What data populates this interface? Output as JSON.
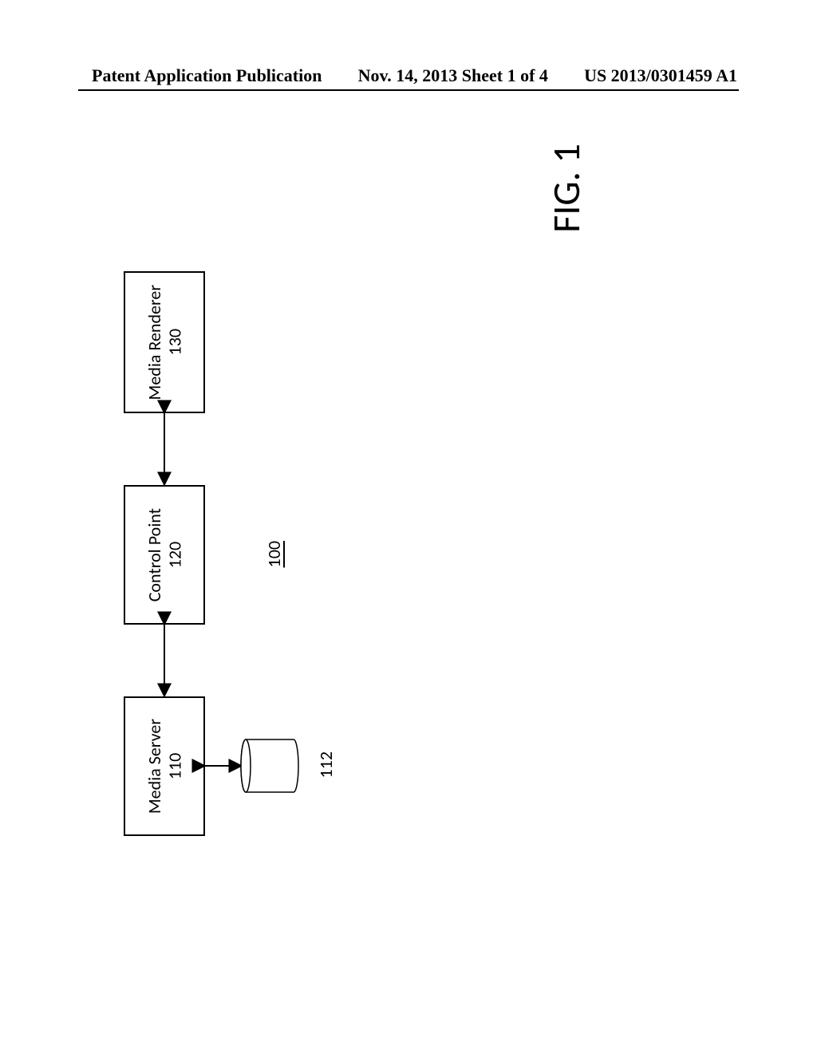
{
  "header": {
    "left": "Patent Application Publication",
    "center": "Nov. 14, 2013  Sheet 1 of 4",
    "right": "US 2013/0301459 A1"
  },
  "diagram": {
    "system_ref": "100",
    "figure_label": "FIG. 1",
    "blocks": {
      "media_server": {
        "label": "Media Server\n110"
      },
      "control_point": {
        "label": "Control Point\n120"
      },
      "media_renderer": {
        "label": "Media Renderer\n130"
      },
      "database_ref": "112"
    }
  }
}
